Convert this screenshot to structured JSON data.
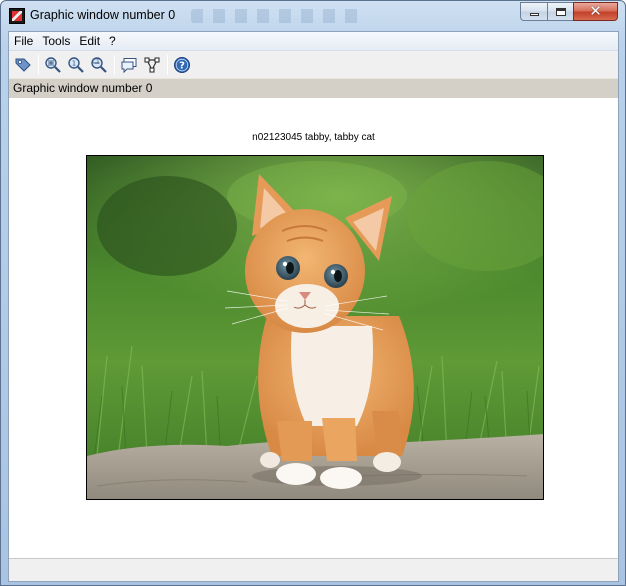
{
  "window": {
    "title": "Graphic window number 0"
  },
  "menu": {
    "items": [
      "File",
      "Tools",
      "Edit",
      "?"
    ]
  },
  "toolbar": {
    "buttons": [
      {
        "name": "rotate-icon"
      },
      {
        "name": "zoom-in-icon"
      },
      {
        "name": "zoom-fit-icon"
      },
      {
        "name": "zoom-out-icon"
      },
      {
        "name": "datatip-icon"
      },
      {
        "name": "curve-editor-icon"
      },
      {
        "name": "help-icon"
      }
    ]
  },
  "infobar": {
    "text": "Graphic window number 0"
  },
  "figure": {
    "title": "n02123045 tabby, tabby cat"
  },
  "colors": {
    "title_bar": "#b9d1ea",
    "close_button": "#c4412b",
    "status_bar": "#d4d0c8"
  }
}
